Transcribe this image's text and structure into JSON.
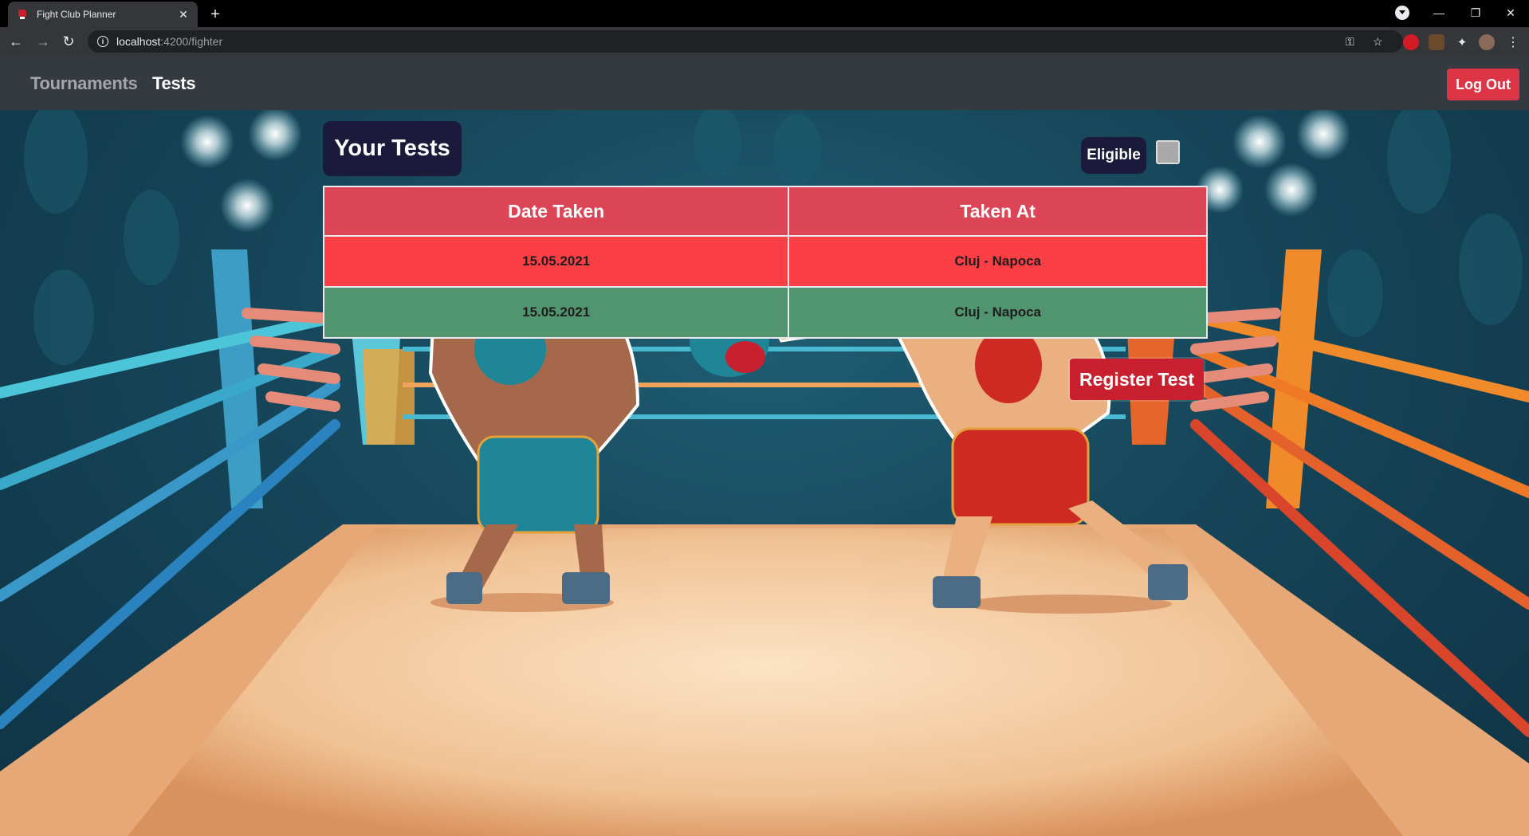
{
  "browser": {
    "tab_title": "Fight Club Planner",
    "url_host": "localhost",
    "url_path": ":4200/fighter"
  },
  "nav": {
    "links": [
      "Tournaments",
      "Tests"
    ],
    "logout_label": "Log Out"
  },
  "page": {
    "title": "Your Tests",
    "eligible_label": "Eligible",
    "eligible_checked": false,
    "register_label": "Register Test"
  },
  "table": {
    "headers": [
      "Date Taken",
      "Taken At"
    ],
    "rows": [
      {
        "date": "15.05.2021",
        "location": "Cluj - Napoca",
        "status": "fail"
      },
      {
        "date": "15.05.2021",
        "location": "Cluj - Napoca",
        "status": "pass"
      }
    ]
  },
  "colors": {
    "nav_bg": "#343a40",
    "danger": "#dc3545",
    "header_red": "#dc4556",
    "row_fail": "#fb3f45",
    "row_pass": "#519470",
    "badge_dark": "#1b1a3a"
  }
}
